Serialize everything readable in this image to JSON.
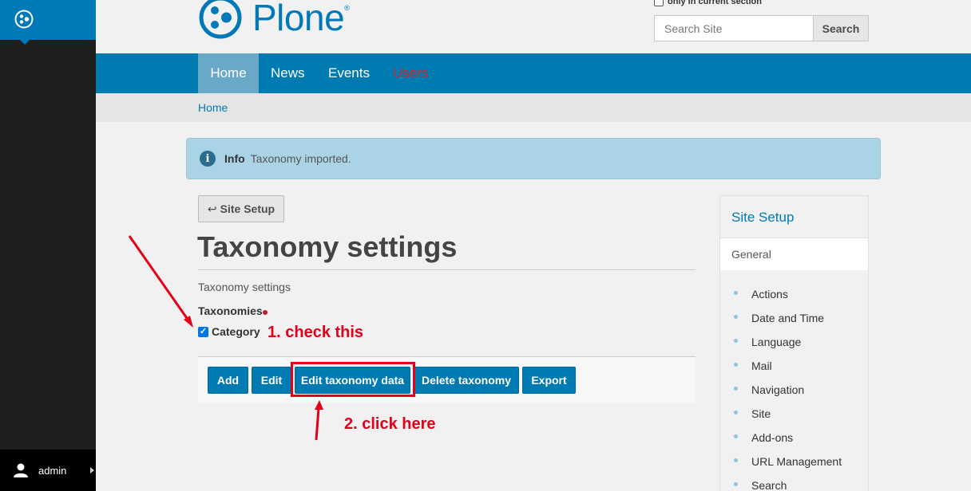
{
  "toolbar": {
    "user": "admin"
  },
  "header": {
    "logo_text": "Plone",
    "logo_mark": "®",
    "search_checkbox_label": "only in current section",
    "search_placeholder": "Search Site",
    "search_button": "Search"
  },
  "nav": {
    "items": [
      {
        "label": "Home"
      },
      {
        "label": "News"
      },
      {
        "label": "Events"
      },
      {
        "label": "Users"
      }
    ]
  },
  "breadcrumbs": {
    "home": "Home"
  },
  "info": {
    "icon": "i",
    "title": "Info",
    "message": "Taxonomy imported."
  },
  "main": {
    "back_button": "Site Setup",
    "back_arrow": "↩",
    "title": "Taxonomy settings",
    "form_label": "Taxonomy settings",
    "taxonomies_label": "Taxonomies",
    "category_label": "Category",
    "category_checked": true,
    "buttons": {
      "add": "Add",
      "edit": "Edit",
      "edit_taxonomy_data": "Edit taxonomy data",
      "delete_taxonomy": "Delete taxonomy",
      "export": "Export"
    }
  },
  "annotations": {
    "step1": "1. check this",
    "step2": "2. click here",
    "color": "#e3001b"
  },
  "portlet": {
    "title": "Site Setup",
    "general": "General",
    "items": [
      "Actions",
      "Date and Time",
      "Language",
      "Mail",
      "Navigation",
      "Site",
      "Add-ons",
      "URL Management",
      "Search"
    ]
  },
  "colors": {
    "brand": "#0079b8",
    "nav_bg": "#007bb1",
    "nav_active": "#69a8c6",
    "users_link": "#d0262b",
    "info_bg": "#aad4e6"
  }
}
